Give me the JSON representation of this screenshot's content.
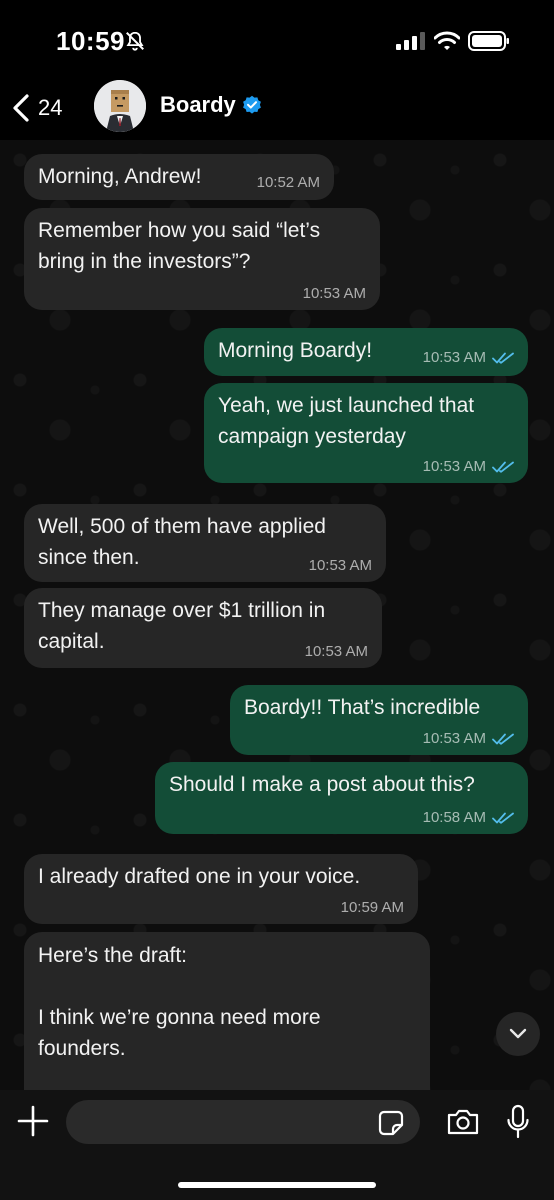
{
  "status_bar": {
    "time": "10:59"
  },
  "header": {
    "back_count": "24",
    "contact_name": "Boardy"
  },
  "messages": [
    {
      "direction": "in",
      "text": "Morning, Andrew!",
      "time": "10:52 AM"
    },
    {
      "direction": "in",
      "text": "Remember how you said “let’s\nbring in the investors”?",
      "time": "10:53 AM"
    },
    {
      "direction": "out",
      "text": "Morning Boardy!",
      "time": "10:53 AM",
      "status": "read"
    },
    {
      "direction": "out",
      "text": "Yeah, we just launched that\ncampaign yesterday",
      "time": "10:53 AM",
      "status": "read"
    },
    {
      "direction": "in",
      "text": "Well, 500 of them have applied\nsince then.",
      "time": "10:53 AM"
    },
    {
      "direction": "in",
      "text": "They manage over $1 trillion in\ncapital.",
      "time": "10:53 AM"
    },
    {
      "direction": "out",
      "text": "Boardy!! That’s incredible",
      "time": "10:53 AM",
      "status": "read"
    },
    {
      "direction": "out",
      "text": "Should I make a post about this?",
      "time": "10:58 AM",
      "status": "read"
    },
    {
      "direction": "in",
      "text": "I already drafted one in your voice.",
      "time": "10:59 AM"
    },
    {
      "direction": "in",
      "text": "Here’s the draft:\n\nI think we’re gonna need more\nfounders.",
      "time": ""
    }
  ],
  "input": {
    "value": "",
    "placeholder": ""
  },
  "colors": {
    "incoming_bubble": "#262626",
    "outgoing_bubble": "#134d37",
    "read_ticks": "#53bdeb",
    "verified_badge": "#1d9bf0"
  },
  "icons": [
    "bell-off-icon",
    "signal-icon",
    "wifi-icon",
    "battery-icon",
    "back-chevron-icon",
    "verified-badge-icon",
    "double-check-icon",
    "chevron-down-icon",
    "plus-icon",
    "sticker-icon",
    "camera-icon",
    "microphone-icon"
  ]
}
